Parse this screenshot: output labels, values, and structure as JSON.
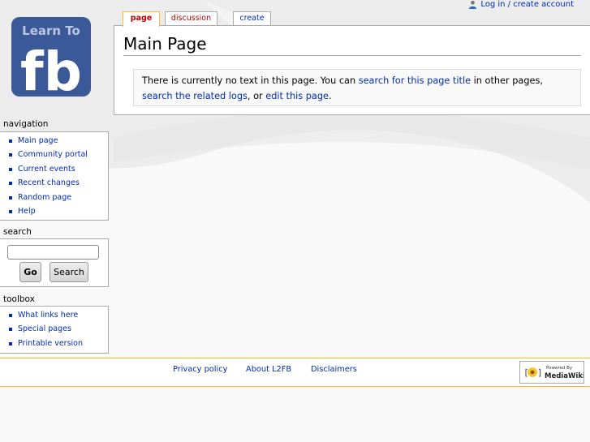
{
  "personal": {
    "login_label": "Log in / create account",
    "icon": "user-icon"
  },
  "tabs": [
    {
      "label": "page",
      "state": "selected"
    },
    {
      "label": "discussion",
      "state": "new"
    },
    {
      "label": "create",
      "state": "normal"
    }
  ],
  "page": {
    "title": "Main Page",
    "notice": {
      "text1": "There is currently no text in this page. You can ",
      "link1": "search for this page title",
      "text2": " in other pages, ",
      "link2": "search the related logs",
      "text3": ", or ",
      "link3": "edit this page",
      "text4": "."
    }
  },
  "logo": {
    "line1": "Learn To",
    "line2": "fb"
  },
  "navigation": {
    "heading": "navigation",
    "items": [
      "Main page",
      "Community portal",
      "Current events",
      "Recent changes",
      "Random page",
      "Help"
    ]
  },
  "search": {
    "heading": "search",
    "value": "",
    "go_label": "Go",
    "search_label": "Search"
  },
  "toolbox": {
    "heading": "toolbox",
    "items": [
      "What links here",
      "Special pages",
      "Printable version"
    ]
  },
  "footer": {
    "links": [
      "Privacy policy",
      "About L2FB",
      "Disclaimers"
    ],
    "powered_by": {
      "line1": "Powered By",
      "line2": "MediaWiki"
    }
  },
  "colors": {
    "link": "#002bb8",
    "new_link": "#ba0000",
    "accent_border": "#fabd23",
    "logo_bg": "#3b5998",
    "border": "#aaaaaa"
  }
}
